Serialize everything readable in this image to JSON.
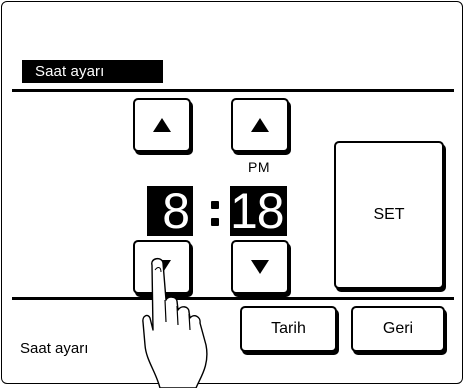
{
  "screen": {
    "title": "Saat ayarı",
    "footer_label": "Saat ayarı"
  },
  "time": {
    "hour": "8",
    "minute": "18",
    "period": "PM"
  },
  "buttons": {
    "hour_up_icon": "triangle-up",
    "hour_down_icon": "triangle-down",
    "minute_up_icon": "triangle-up",
    "minute_down_icon": "triangle-down",
    "set_label": "SET",
    "date_label": "Tarih",
    "back_label": "Geri"
  }
}
